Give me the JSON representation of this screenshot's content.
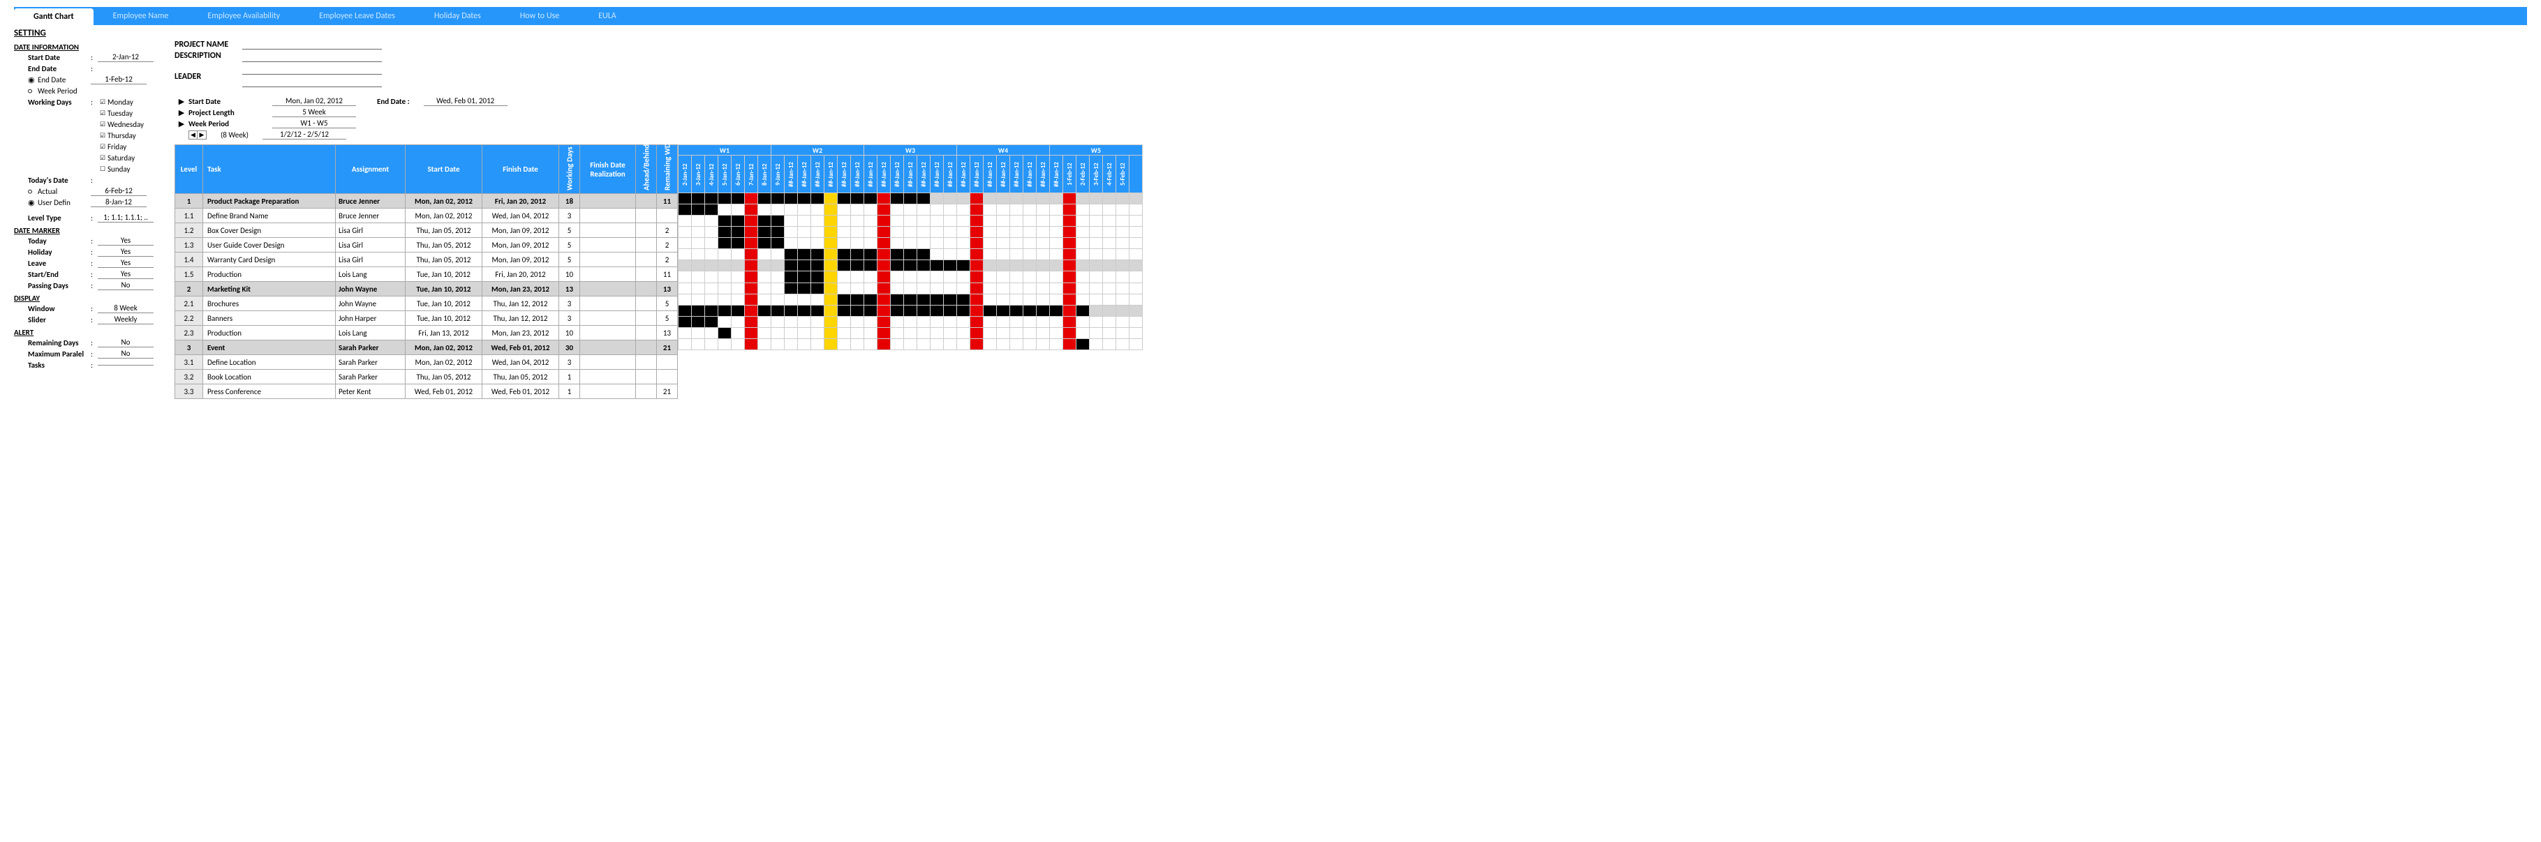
{
  "tabs": {
    "active": "Gantt Chart",
    "items": [
      "Employee Name",
      "Employee Availability",
      "Employee Leave Dates",
      "Holiday Dates",
      "How to Use",
      "EULA"
    ]
  },
  "setting_title": "SETTING",
  "date_info": {
    "header": "DATE INFORMATION",
    "start_date_label": "Start Date",
    "start_date": "2-Jan-12",
    "end_date_label": "End Date",
    "end_date_radio": "End Date",
    "end_date": "1-Feb-12",
    "week_period_radio": "Week Period",
    "working_days_label": "Working Days",
    "days": [
      "Monday",
      "Tuesday",
      "Wednesday",
      "Thursday",
      "Friday",
      "Saturday",
      "Sunday"
    ],
    "days_checked": [
      true,
      true,
      true,
      true,
      true,
      true,
      false
    ]
  },
  "project": {
    "name_label": "PROJECT NAME",
    "desc_label": "DESCRIPTION",
    "leader_label": "LEADER",
    "start_label": "Start Date",
    "start_val": "Mon, Jan 02, 2012",
    "end_label": "End Date :",
    "end_val": "Wed, Feb 01, 2012",
    "length_label": "Project Length",
    "length_val": "5 Week",
    "period_label": "Week Period",
    "period_val": "W1 - W5",
    "spinner_note": "(8 Week)",
    "spinner_range": "1/2/12 - 2/5/12"
  },
  "todays_date": {
    "label": "Today's Date",
    "actual": "Actual",
    "actual_val": "6-Feb-12",
    "user": "User Defin",
    "user_val": "8-Jan-12"
  },
  "level_type": {
    "label": "Level Type",
    "val": "1; 1.1; 1.1.1; .."
  },
  "date_marker": {
    "header": "DATE MARKER",
    "rows": [
      {
        "label": "Today",
        "val": "Yes"
      },
      {
        "label": "Holiday",
        "val": "Yes"
      },
      {
        "label": "Leave",
        "val": "Yes"
      },
      {
        "label": "Start/End",
        "val": "Yes"
      },
      {
        "label": "Passing Days",
        "val": "No"
      }
    ]
  },
  "display": {
    "header": "DISPLAY",
    "rows": [
      {
        "label": "Window",
        "val": "8 Week"
      },
      {
        "label": "Slider",
        "val": "Weekly"
      }
    ]
  },
  "alert": {
    "header": "ALERT",
    "rows": [
      {
        "label": "Remaining Days",
        "val": "No"
      },
      {
        "label": "Maximum Paralel",
        "val": "No"
      },
      {
        "label": "Tasks",
        "val": ""
      }
    ]
  },
  "table_headers": {
    "level": "Level",
    "task": "Task",
    "assignment": "Assignment",
    "start": "Start Date",
    "finish": "Finish Date",
    "wd": "Working Days",
    "real": "Finish Date Realization",
    "ab": "Ahead/Behind",
    "rwd": "Remaining WD"
  },
  "weeks": [
    "W1",
    "W2",
    "W3",
    "W4",
    "W5"
  ],
  "dates": [
    "2-Jan-12",
    "3-Jan-12",
    "4-Jan-12",
    "5-Jan-12",
    "6-Jan-12",
    "7-Jan-12",
    "8-Jan-12",
    "9-Jan-12",
    "##-Jan-12",
    "##-Jan-12",
    "##-Jan-12",
    "##-Jan-12",
    "##-Jan-12",
    "##-Jan-12",
    "##-Jan-12",
    "##-Jan-12",
    "##-Jan-12",
    "##-Jan-12",
    "##-Jan-12",
    "##-Jan-12",
    "##-Jan-12",
    "##-Jan-12",
    "##-Jan-12",
    "##-Jan-12",
    "##-Jan-12",
    "##-Jan-12",
    "##-Jan-12",
    "##-Jan-12",
    "##-Jan-12",
    "1-Feb-12",
    "2-Feb-12",
    "3-Feb-12",
    "4-Feb-12",
    "5-Feb-12"
  ],
  "rows": [
    {
      "level": "1",
      "task": "Product Package Preparation",
      "assign": "Bruce Jenner",
      "start": "Mon, Jan 02, 2012",
      "finish": "Fri, Jan 20, 2012",
      "wd": "18",
      "rwd": "11",
      "group": true,
      "bar_start": 0,
      "bar_end": 18
    },
    {
      "level": "1.1",
      "task": "Define Brand Name",
      "assign": "Bruce Jenner",
      "start": "Mon, Jan 02, 2012",
      "finish": "Wed, Jan 04, 2012",
      "wd": "3",
      "rwd": "",
      "bar_start": 0,
      "bar_end": 2
    },
    {
      "level": "1.2",
      "task": "Box Cover Design",
      "assign": "Lisa Girl",
      "start": "Thu, Jan 05, 2012",
      "finish": "Mon, Jan 09, 2012",
      "wd": "5",
      "rwd": "2",
      "bar_start": 3,
      "bar_end": 7
    },
    {
      "level": "1.3",
      "task": "User Guide Cover Design",
      "assign": "Lisa Girl",
      "start": "Thu, Jan 05, 2012",
      "finish": "Mon, Jan 09, 2012",
      "wd": "5",
      "rwd": "2",
      "bar_start": 3,
      "bar_end": 7
    },
    {
      "level": "1.4",
      "task": "Warranty Card Design",
      "assign": "Lisa Girl",
      "start": "Thu, Jan 05, 2012",
      "finish": "Mon, Jan 09, 2012",
      "wd": "5",
      "rwd": "2",
      "bar_start": 3,
      "bar_end": 7
    },
    {
      "level": "1.5",
      "task": "Production",
      "assign": "Lois Lang",
      "start": "Tue, Jan 10, 2012",
      "finish": "Fri, Jan 20, 2012",
      "wd": "10",
      "rwd": "11",
      "bar_start": 8,
      "bar_end": 18
    },
    {
      "level": "2",
      "task": "Marketing Kit",
      "assign": "John Wayne",
      "start": "Tue, Jan 10, 2012",
      "finish": "Mon, Jan 23, 2012",
      "wd": "13",
      "rwd": "13",
      "group": true,
      "bar_start": 8,
      "bar_end": 21
    },
    {
      "level": "2.1",
      "task": "Brochures",
      "assign": "John Wayne",
      "start": "Tue, Jan 10, 2012",
      "finish": "Thu, Jan 12, 2012",
      "wd": "3",
      "rwd": "5",
      "bar_start": 8,
      "bar_end": 10
    },
    {
      "level": "2.2",
      "task": "Banners",
      "assign": "John Harper",
      "start": "Tue, Jan 10, 2012",
      "finish": "Thu, Jan 12, 2012",
      "wd": "3",
      "rwd": "5",
      "bar_start": 8,
      "bar_end": 10
    },
    {
      "level": "2.3",
      "task": "Production",
      "assign": "Lois Lang",
      "start": "Fri, Jan 13, 2012",
      "finish": "Mon, Jan 23, 2012",
      "wd": "10",
      "rwd": "13",
      "bar_start": 11,
      "bar_end": 21
    },
    {
      "level": "3",
      "task": "Event",
      "assign": "Sarah Parker",
      "start": "Mon, Jan 02, 2012",
      "finish": "Wed, Feb 01, 2012",
      "wd": "30",
      "rwd": "21",
      "group": true,
      "bar_start": 0,
      "bar_end": 30
    },
    {
      "level": "3.1",
      "task": "Define Location",
      "assign": "Sarah Parker",
      "start": "Mon, Jan 02, 2012",
      "finish": "Wed, Jan 04, 2012",
      "wd": "3",
      "rwd": "",
      "bar_start": 0,
      "bar_end": 2
    },
    {
      "level": "3.2",
      "task": "Book Location",
      "assign": "Sarah Parker",
      "start": "Thu, Jan 05, 2012",
      "finish": "Thu, Jan 05, 2012",
      "wd": "1",
      "rwd": "",
      "bar_start": 3,
      "bar_end": 3
    },
    {
      "level": "3.3",
      "task": "Press Conference",
      "assign": "Peter Kent",
      "start": "Wed, Feb 01, 2012",
      "finish": "Wed, Feb 01, 2012",
      "wd": "1",
      "rwd": "21",
      "bar_start": 30,
      "bar_end": 30
    }
  ],
  "markers": {
    "red": [
      5,
      15,
      22,
      29
    ],
    "yellow": [
      11
    ]
  }
}
